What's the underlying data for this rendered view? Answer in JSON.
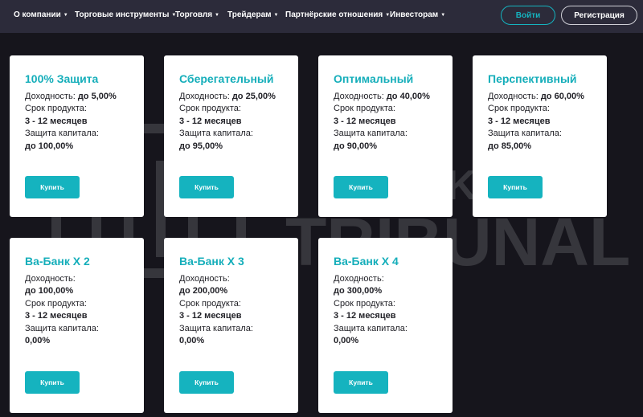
{
  "nav": {
    "items": [
      {
        "label": "О компании"
      },
      {
        "label": "Торговые инструменты"
      },
      {
        "label": "Торговля"
      },
      {
        "label": "Трейдерам"
      },
      {
        "label": "Партнёрские отношения"
      },
      {
        "label": "Инвесторам"
      }
    ],
    "caret": "▼",
    "login_label": "Войти",
    "register_label": "Регистрация"
  },
  "watermark": {
    "line1": "BROKER",
    "line2": "TRIBUNAL"
  },
  "cards": [
    {
      "title": "100% Защита",
      "yield_label": "Доходность:",
      "yield_value": "до 5,00%",
      "term_label": "Срок продукта:",
      "term_value": "3 - 12 месяцев",
      "protection_label": "Защита капитала:",
      "protection_value": "до 100,00%",
      "button_label": "Купить"
    },
    {
      "title": "Сберегательный",
      "yield_label": "Доходность:",
      "yield_value": "до 25,00%",
      "term_label": "Срок продукта:",
      "term_value": "3 - 12 месяцев",
      "protection_label": "Защита капитала:",
      "protection_value": "до 95,00%",
      "button_label": "Купить"
    },
    {
      "title": "Оптимальный",
      "yield_label": "Доходность:",
      "yield_value": "до 40,00%",
      "term_label": "Срок продукта:",
      "term_value": "3 - 12 месяцев",
      "protection_label": "Защита капитала:",
      "protection_value": "до 90,00%",
      "button_label": "Купить"
    },
    {
      "title": "Перспективный",
      "yield_label": "Доходность:",
      "yield_value": "до 60,00%",
      "term_label": "Срок продукта:",
      "term_value": "3 - 12 месяцев",
      "protection_label": "Защита капитала:",
      "protection_value": "до 85,00%",
      "button_label": "Купить"
    },
    {
      "title": "Ва-Банк X 2",
      "yield_label": "Доходность:",
      "yield_value": "до 100,00%",
      "term_label": "Срок продукта:",
      "term_value": "3 - 12 месяцев",
      "protection_label": "Защита капитала:",
      "protection_value": "0,00%",
      "button_label": "Купить"
    },
    {
      "title": "Ва-Банк X 3",
      "yield_label": "Доходность:",
      "yield_value": "до 200,00%",
      "term_label": "Срок продукта:",
      "term_value": "3 - 12 месяцев",
      "protection_label": "Защита капитала:",
      "protection_value": "0,00%",
      "button_label": "Купить"
    },
    {
      "title": "Ва-Банк X 4",
      "yield_label": "Доходность:",
      "yield_value": "до 300,00%",
      "term_label": "Срок продукта:",
      "term_value": "3 - 12 месяцев",
      "protection_label": "Защита капитала:",
      "protection_value": "0,00%",
      "button_label": "Купить"
    }
  ]
}
